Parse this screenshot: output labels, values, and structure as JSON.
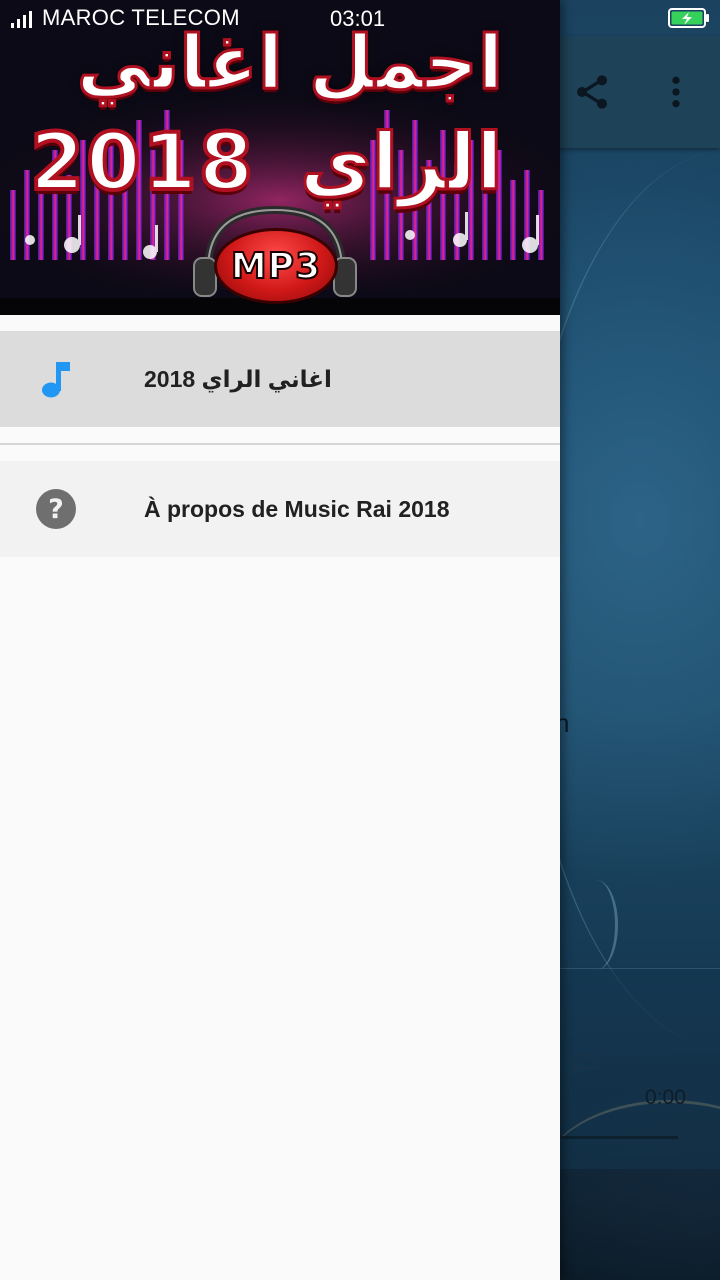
{
  "status_bar": {
    "carrier": "MAROC TELECOM",
    "time": "03:01"
  },
  "drawer": {
    "header": {
      "title_line1": "اجمل اغاني",
      "title_line2_word": "الراي",
      "title_line2_year": "2018",
      "badge": "MP3"
    },
    "items": [
      {
        "label": "اغاني الراي 2018",
        "icon": "music-note-icon",
        "selected": true
      },
      {
        "label": "À propos de Music Rai 2018",
        "icon": "help-circle-icon",
        "selected": false
      }
    ]
  },
  "background_app": {
    "title_fragment": "h",
    "player": {
      "time": "0:00"
    }
  },
  "colors": {
    "accent": "#2196f3",
    "selected_item_bg": "#dcdcdc",
    "drawer_bg": "#fafafa",
    "toolbar_bg": "#1e4258"
  }
}
